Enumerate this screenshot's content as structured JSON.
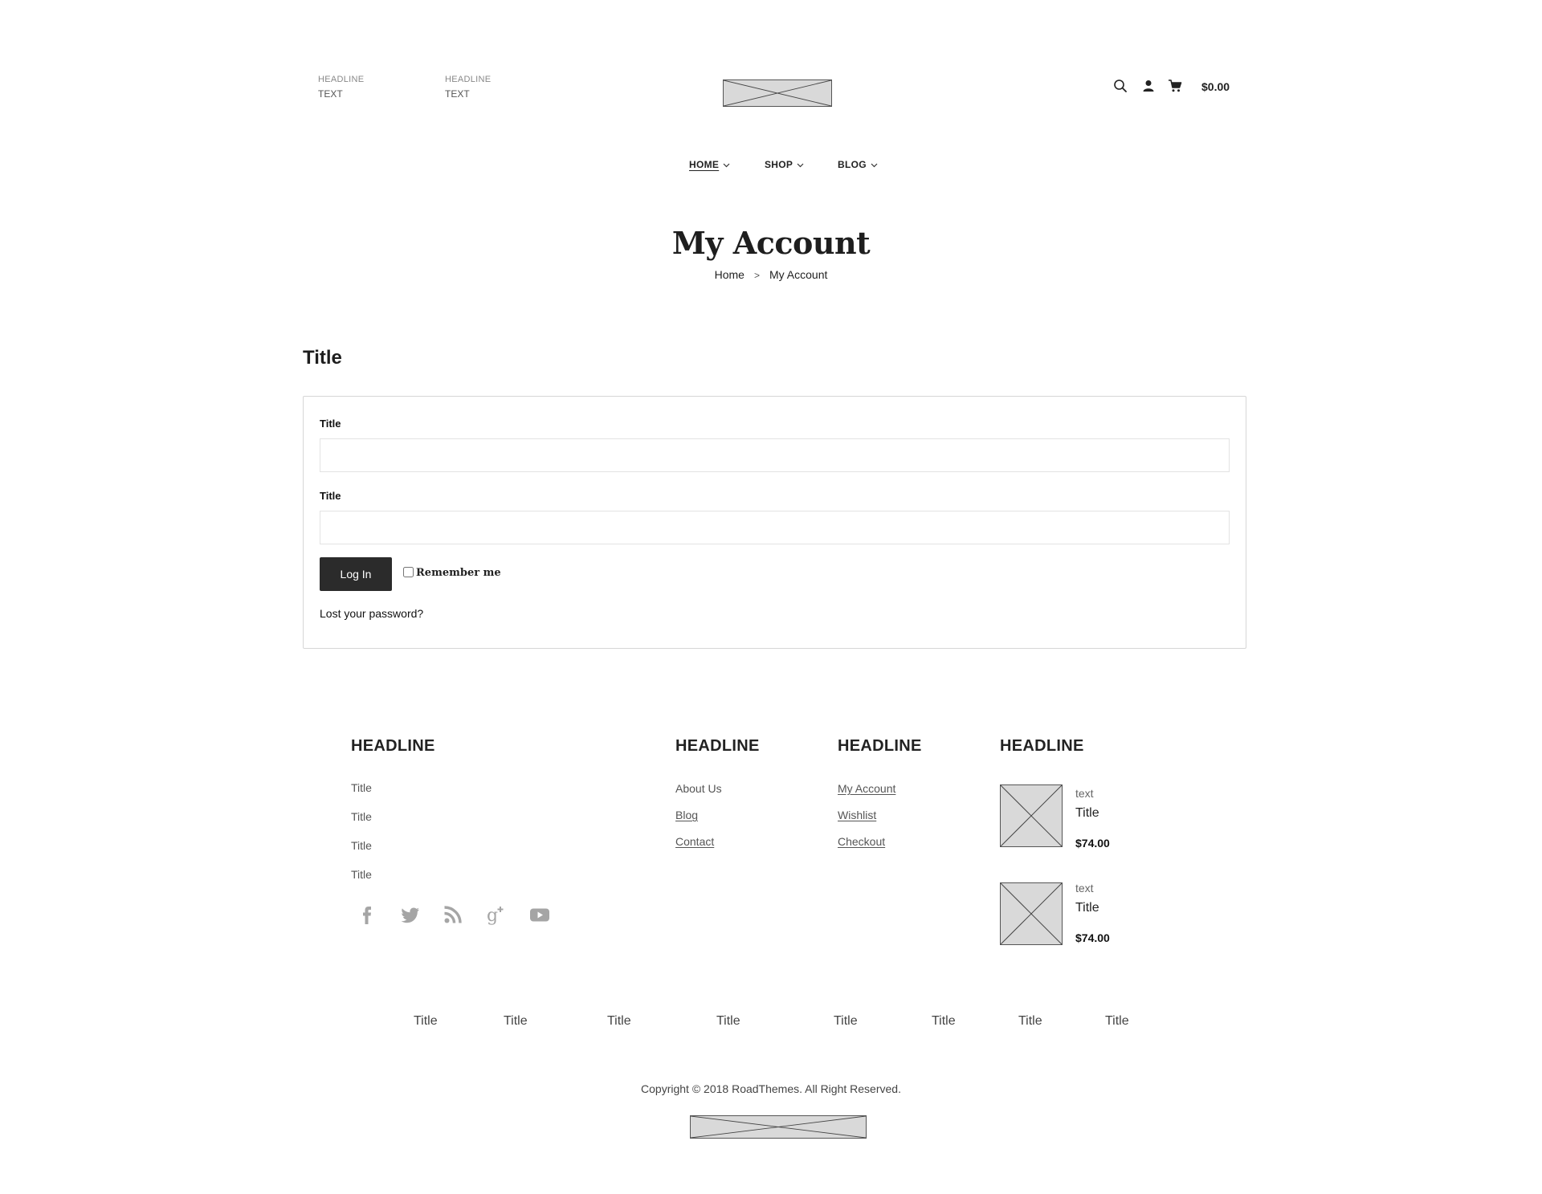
{
  "header": {
    "info_blocks": [
      {
        "headline": "HEADLINE",
        "text": "TEXT"
      },
      {
        "headline": "HEADLINE",
        "text": "TEXT"
      }
    ],
    "icons": [
      "search-icon",
      "user-icon",
      "cart-icon"
    ],
    "cart_total": "$0.00"
  },
  "nav": {
    "items": [
      {
        "label": "HOME",
        "active": true
      },
      {
        "label": "SHOP",
        "active": false
      },
      {
        "label": "BLOG",
        "active": false
      }
    ]
  },
  "page": {
    "title": "My Account",
    "breadcrumb": {
      "home": "Home",
      "separator": ">",
      "current": "My Account"
    }
  },
  "login": {
    "section_title": "Title",
    "field1_label": "Title",
    "field1_value": "",
    "field2_label": "Title",
    "field2_value": "",
    "submit_label": "Log In",
    "remember_label": "Remember me",
    "remember_checked": false,
    "lost_password": "Lost your password?"
  },
  "footer": {
    "columns": [
      {
        "headline": "HEADLINE",
        "links": [
          "Title",
          "Title",
          "Title",
          "Title"
        ]
      },
      {
        "headline": "HEADLINE",
        "links": [
          "About Us",
          "Blog",
          "Contact"
        ]
      },
      {
        "headline": "HEADLINE",
        "links": [
          "My Account",
          "Wishlist",
          "Checkout"
        ]
      },
      {
        "headline": "HEADLINE"
      }
    ],
    "social_icons": [
      "facebook-icon",
      "twitter-icon",
      "rss-icon",
      "google-plus-icon",
      "youtube-icon"
    ],
    "products": [
      {
        "text": "text",
        "title": "Title",
        "price": "$74.00"
      },
      {
        "text": "text",
        "title": "Title",
        "price": "$74.00"
      }
    ],
    "bottom_links": [
      "Title",
      "Title",
      "Title",
      "Title",
      "Title",
      "Title",
      "Title",
      "Title"
    ],
    "copyright": "Copyright © 2018 RoadThemes. All Right Reserved."
  }
}
